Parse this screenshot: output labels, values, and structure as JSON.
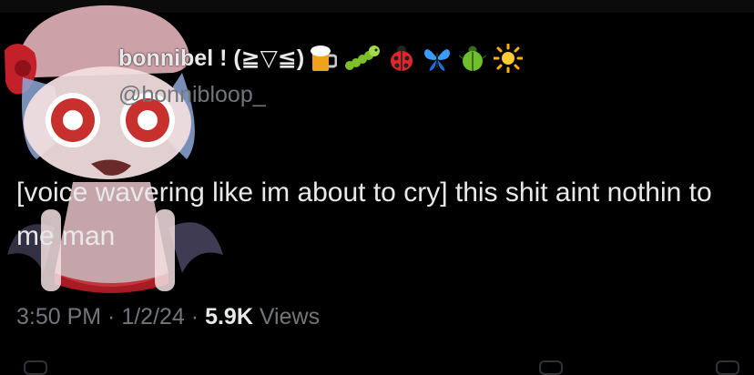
{
  "tweet": {
    "display_name": "bonnibel ! (≧▽≦)",
    "handle": "@bonnibloop_",
    "name_emojis": [
      "beer-mug",
      "caterpillar",
      "ladybug",
      "butterfly",
      "beetle",
      "sun"
    ],
    "text": "[voice wavering like im about to cry] this shit aint nothin to me man",
    "time": "3:50 PM",
    "separator": " · ",
    "date": "1/2/24",
    "view_count": "5.9K",
    "views_label": "Views"
  },
  "colors": {
    "background": "#000000",
    "primary_text": "#e7e9ea",
    "secondary_text": "#71767b"
  }
}
